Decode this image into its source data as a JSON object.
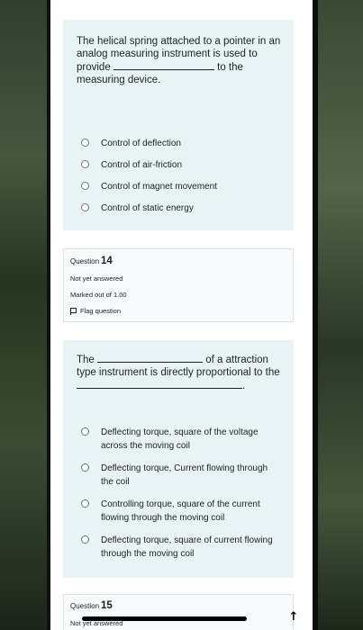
{
  "question13": {
    "text_part1": "The helical spring attached to a pointer in an analog measuring instrument is used to provide",
    "text_part2": "to the measuring device.",
    "options": [
      "Control of deflection",
      "Control of air-friction",
      "Control of magnet movement",
      "Control of static energy"
    ]
  },
  "question14_info": {
    "label": "Question",
    "number": "14",
    "status": "Not yet answered",
    "marks": "Marked out of 1.00",
    "flag": "Flag question"
  },
  "question14": {
    "text_part1": "The",
    "text_part2": "of a attraction type instrument is directly proportional to the",
    "text_end": ".",
    "options": [
      "Deflecting torque, square of the voltage across the moving coil",
      "Deflecting torque, Current flowing through the  coil",
      "Controlling torque, square of the current flowing through the moving coil",
      "Deflecting torque, square of current flowing through the moving coil"
    ]
  },
  "question15_info": {
    "label": "Question",
    "number": "15",
    "status": "Not yet answered"
  },
  "icons": {
    "scroll_up": "arrow-up-icon",
    "flag": "flag-icon",
    "radio": "radio-icon"
  }
}
